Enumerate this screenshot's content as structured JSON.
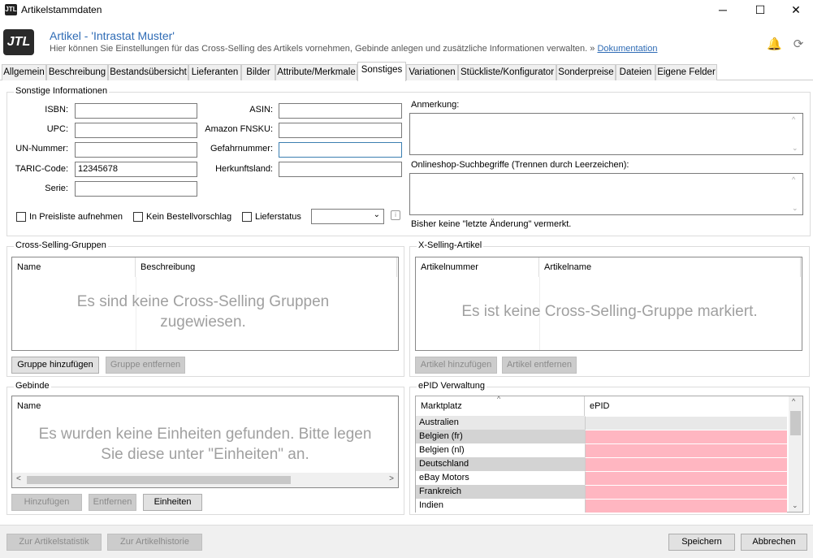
{
  "window": {
    "title": "Artikelstammdaten",
    "logo_text": "JTL"
  },
  "header": {
    "logo_text": "JTL",
    "title": "Artikel - 'Intrastat Muster'",
    "subtitle": "Hier können Sie Einstellungen für das Cross-Selling des Artikels vornehmen, Gebinde anlegen und zusätzliche Informationen verwalten.",
    "doc_prefix": "»",
    "doc_link": "Dokumentation"
  },
  "tabs": [
    "Allgemein",
    "Beschreibung",
    "Bestandsübersicht",
    "Lieferanten",
    "Bilder",
    "Attribute/Merkmale",
    "Sonstiges",
    "Variationen",
    "Stückliste/Konfigurator",
    "Sonderpreise",
    "Dateien",
    "Eigene Felder"
  ],
  "active_tab": "Sonstiges",
  "sonstige": {
    "title": "Sonstige Informationen",
    "isbn_label": "ISBN:",
    "isbn_value": "",
    "upc_label": "UPC:",
    "upc_value": "",
    "un_label": "UN-Nummer:",
    "un_value": "",
    "taric_label": "TARIC-Code:",
    "taric_value": "12345678",
    "serie_label": "Serie:",
    "serie_value": "",
    "asin_label": "ASIN:",
    "asin_value": "",
    "fnsku_label": "Amazon FNSKU:",
    "fnsku_value": "",
    "gefahr_label": "Gefahrnummer:",
    "gefahr_value": "",
    "herkunft_label": "Herkunftsland:",
    "herkunft_value": "",
    "cb_preisliste": "In Preisliste aufnehmen",
    "cb_bestellvorschlag": "Kein Bestellvorschlag",
    "cb_lieferstatus": "Lieferstatus",
    "anmerkung_label": "Anmerkung:",
    "suchbegriffe_label": "Onlineshop-Suchbegriffe (Trennen durch Leerzeichen):",
    "last_change": "Bisher keine \"letzte Änderung\" vermerkt."
  },
  "cross_selling": {
    "title": "Cross-Selling-Gruppen",
    "col_name": "Name",
    "col_desc": "Beschreibung",
    "empty": "Es sind keine Cross-Selling Gruppen zugewiesen.",
    "btn_add": "Gruppe hinzufügen",
    "btn_remove": "Gruppe entfernen"
  },
  "x_selling": {
    "title": "X-Selling-Artikel",
    "col_nr": "Artikelnummer",
    "col_name": "Artikelname",
    "empty": "Es ist keine Cross-Selling-Gruppe markiert.",
    "btn_add": "Artikel hinzufügen",
    "btn_remove": "Artikel entfernen"
  },
  "gebinde": {
    "title": "Gebinde",
    "col_name": "Name",
    "empty": "Es wurden keine Einheiten gefunden. Bitte legen Sie diese unter \"Einheiten\" an.",
    "btn_add": "Hinzufügen",
    "btn_remove": "Entfernen",
    "btn_units": "Einheiten"
  },
  "epid": {
    "title": "ePID Verwaltung",
    "col_market": "Marktplatz",
    "col_epid": "ePID",
    "rows": [
      "Australien",
      "Belgien (fr)",
      "Belgien (nl)",
      "Deutschland",
      "eBay Motors",
      "Frankreich",
      "Indien"
    ]
  },
  "footer": {
    "btn_stats": "Zur Artikelstatistik",
    "btn_history": "Zur Artikelhistorie",
    "btn_save": "Speichern",
    "btn_cancel": "Abbrechen"
  }
}
